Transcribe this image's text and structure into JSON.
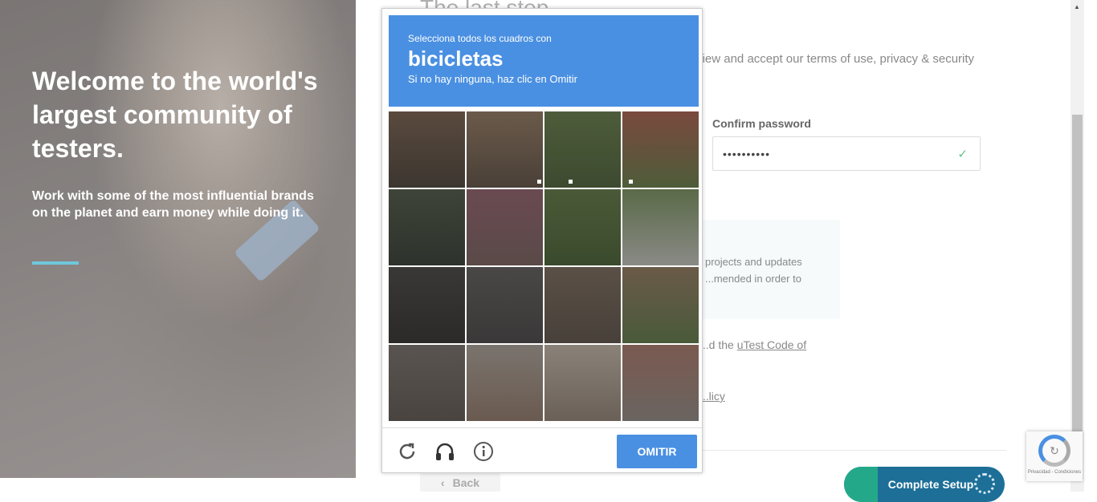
{
  "hero": {
    "title": "Welcome to the world's largest community of testers.",
    "subtitle": "Work with some of the most influential brands on the planet and earn money while doing it."
  },
  "form": {
    "step_title": "The last step",
    "intro": "Please create a password for your account. Then review and accept our terms of use, privacy & security policy to complete the setup process.",
    "confirm_label": "Confirm password",
    "confirm_value": "••••••••••",
    "notice_text": "projects and updates ...mended in order to",
    "terms_text": "...d the",
    "terms_link": "uTest Code of",
    "privacy_link": "...licy",
    "back_label": "Back",
    "complete_label": "Complete Setup"
  },
  "captcha": {
    "instruction": "Selecciona todos los cuadros con",
    "target": "bicicletas",
    "hint": "Si no hay ninguna, haz clic en Omitir",
    "skip_label": "OMITIR",
    "tiles": [
      {
        "colors": [
          "#5a4a3e",
          "#3c3630"
        ]
      },
      {
        "colors": [
          "#6b5a4a",
          "#4a4038"
        ]
      },
      {
        "colors": [
          "#4d5c3a",
          "#3d4a30"
        ]
      },
      {
        "colors": [
          "#7a4a3e",
          "#4e5c3a"
        ]
      },
      {
        "colors": [
          "#3e4438",
          "#2e322c"
        ]
      },
      {
        "colors": [
          "#6a4a52",
          "#5a4a48"
        ]
      },
      {
        "colors": [
          "#4a5a38",
          "#3a4a2c"
        ]
      },
      {
        "colors": [
          "#5a6a48",
          "#8a8a86"
        ]
      },
      {
        "colors": [
          "#3a3836",
          "#2c2a28"
        ]
      },
      {
        "colors": [
          "#4a4846",
          "#3a3838"
        ]
      },
      {
        "colors": [
          "#5a5046",
          "#48403a"
        ]
      },
      {
        "colors": [
          "#6a5a48",
          "#4a5a3a"
        ]
      },
      {
        "colors": [
          "#5a5450",
          "#4a4440"
        ]
      },
      {
        "colors": [
          "#7a746e",
          "#6a5a50"
        ]
      },
      {
        "colors": [
          "#8a8278",
          "#6a6058"
        ]
      },
      {
        "colors": [
          "#7a5a50",
          "#6a6460"
        ]
      }
    ]
  },
  "badge": {
    "text": "Privacidad - Condiciones"
  },
  "colors": {
    "brand_blue": "#4a90e2",
    "complete_button": "#1d6f98",
    "accent_teal": "#6fc7db"
  }
}
